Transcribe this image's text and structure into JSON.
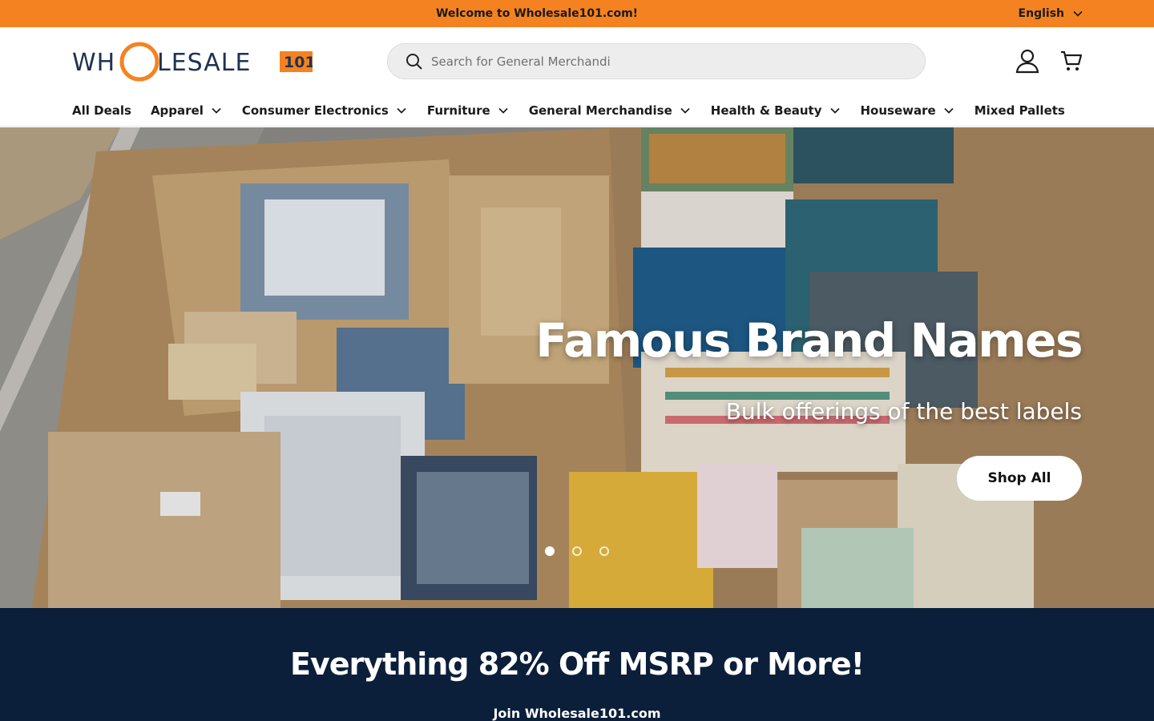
{
  "announcement": {
    "text": "Welcome to Wholesale101.com!",
    "language": "English"
  },
  "header": {
    "logo": {
      "text_left": "WH",
      "text_right": "LESALE",
      "badge": "101"
    },
    "search": {
      "placeholder": "Search for General Merchandi"
    },
    "icons": {
      "account": "user-icon",
      "cart": "cart-icon"
    }
  },
  "nav": {
    "items": [
      {
        "label": "All Deals",
        "dropdown": false
      },
      {
        "label": "Apparel",
        "dropdown": true
      },
      {
        "label": "Consumer Electronics",
        "dropdown": true
      },
      {
        "label": "Furniture",
        "dropdown": true
      },
      {
        "label": "General Merchandise",
        "dropdown": true
      },
      {
        "label": "Health & Beauty",
        "dropdown": true
      },
      {
        "label": "Houseware",
        "dropdown": true
      },
      {
        "label": "Mixed Pallets",
        "dropdown": false
      }
    ]
  },
  "hero": {
    "title": "Famous Brand Names",
    "subtitle": "Bulk offerings of the best labels",
    "button": "Shop All",
    "slides_total": 3,
    "active_slide": 1
  },
  "promo": {
    "title": "Everything 82% Off MSRP or More!",
    "link": "Join Wholesale101.com"
  },
  "colors": {
    "accent": "#f58220",
    "navy": "#0b1f3a",
    "text": "#1b1b1b"
  }
}
